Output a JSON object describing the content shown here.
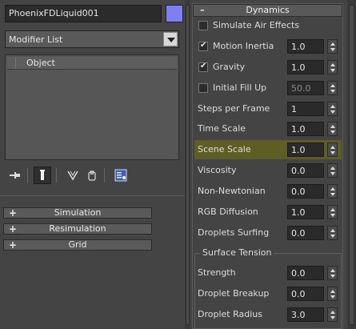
{
  "object": {
    "name": "PhoenixFDLiquid001",
    "color": "#7f7ff2"
  },
  "modifier_list": {
    "label": "Modifier List"
  },
  "stack": {
    "header": "Object"
  },
  "toolbar": {
    "icons": [
      "pin-stack-icon",
      "show-end-result-icon",
      "make-unique-icon",
      "remove-modifier-icon",
      "configure-modifier-sets-icon"
    ]
  },
  "rollouts": [
    {
      "label": "Simulation"
    },
    {
      "label": "Resimulation"
    },
    {
      "label": "Grid"
    }
  ],
  "dynamics": {
    "title": "Dynamics",
    "simulate_air_effects": {
      "label": "Simulate Air Effects",
      "checked": false
    },
    "motion_inertia": {
      "label": "Motion Inertia",
      "checked": true,
      "value": "1.0"
    },
    "gravity": {
      "label": "Gravity",
      "checked": true,
      "value": "1.0"
    },
    "initial_fill_up": {
      "label": "Initial Fill Up",
      "checked": false,
      "value": "50.0"
    },
    "steps_per_frame": {
      "label": "Steps per Frame",
      "value": "1"
    },
    "time_scale": {
      "label": "Time Scale",
      "value": "1.0"
    },
    "scene_scale": {
      "label": "Scene Scale",
      "value": "1.0",
      "highlight_color": "#5e5e24"
    },
    "viscosity": {
      "label": "Viscosity",
      "value": "0.0"
    },
    "non_newtonian": {
      "label": "Non-Newtonian",
      "value": "0.0"
    },
    "rgb_diffusion": {
      "label": "RGB Diffusion",
      "value": "1.0"
    },
    "droplets_surfing": {
      "label": "Droplets Surfing",
      "value": "0.0"
    },
    "surface_tension": {
      "title": "Surface Tension",
      "strength": {
        "label": "Strength",
        "value": "0.0"
      },
      "droplet_breakup": {
        "label": "Droplet Breakup",
        "value": "0.0"
      },
      "droplet_radius": {
        "label": "Droplet Radius",
        "value": "3.0"
      }
    }
  }
}
